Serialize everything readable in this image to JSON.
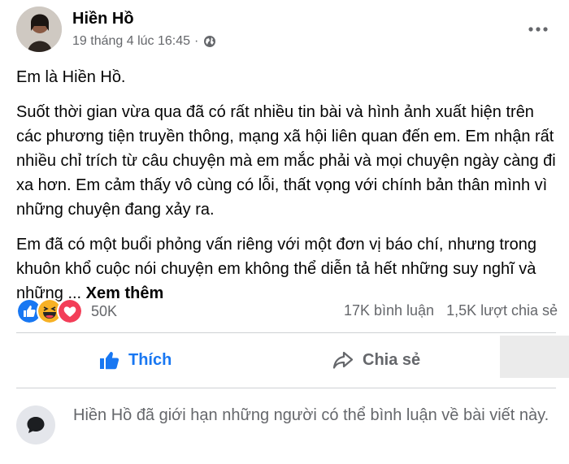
{
  "post": {
    "author": "Hiền Hồ",
    "timestamp": "19 tháng 4 lúc 16:45",
    "separator": "·",
    "privacy_icon": "globe-icon",
    "more_icon": "more-dots-icon",
    "paragraphs": [
      "Em là Hiền Hồ.",
      "Suốt thời gian vừa qua đã có rất nhiều tin bài và hình ảnh xuất hiện trên các phương tiện truyền thông, mạng xã hội liên quan đến em. Em nhận rất nhiều chỉ trích từ câu chuyện mà em mắc phải và mọi chuyện ngày càng đi xa hơn. Em cảm thấy vô cùng có lỗi, thất vọng với chính bản thân mình vì những chuyện đang xảy ra."
    ],
    "last_paragraph": "Em đã có một buổi phỏng vấn riêng với một đơn vị báo chí, nhưng trong khuôn khổ cuộc nói chuyện em không thể diễn tả hết những suy nghĩ và những ...",
    "see_more": "Xem thêm"
  },
  "engagement": {
    "reaction_icons": [
      "like-icon",
      "haha-icon",
      "love-icon"
    ],
    "reaction_count": "50K",
    "comments": "17K bình luận",
    "shares": "1,5K lượt chia sẻ"
  },
  "actions": {
    "like_label": "Thích",
    "share_label": "Chia sẻ"
  },
  "restriction": {
    "text": "Hiền Hồ đã giới hạn những người có thể bình luận về bài viết này."
  },
  "colors": {
    "accent": "#1877f2",
    "secondary_text": "#65676b",
    "love": "#f33e58",
    "haha": "#f7b125"
  }
}
